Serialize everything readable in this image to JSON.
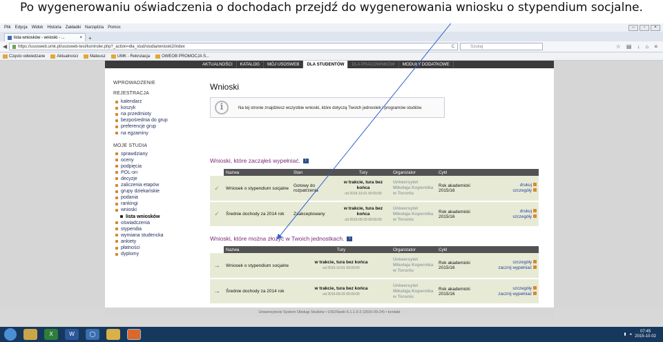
{
  "caption": "Po wygenerowaniu oświadczenia o dochodach  przejdź do wygenerowania wniosku o stypendium socjalne.",
  "browser": {
    "menu": [
      "Plik",
      "Edycja",
      "Widok",
      "Historia",
      "Zakładki",
      "Narzędzia",
      "Pomoc"
    ],
    "tab_title": "lista wniosków - wnioski - ...",
    "tab_close": "×",
    "new_tab": "+",
    "url": "https://usosweb.umk.pl/usosweb-test/kontroler.php?_action=dla_stud/studia/wnioski2/index",
    "search_placeholder": "Szukaj",
    "win_min": "–",
    "win_max": "▫",
    "win_close": "×",
    "back": "◀",
    "reload": "C",
    "bookmarks": [
      "Często odwiedzane",
      "Aktualności",
      "Mateusz",
      "UMK - Rekrutacja",
      "OWEOB PROMOCJA S..."
    ]
  },
  "topnav": {
    "items": [
      "AKTUALNOŚCI",
      "KATALOG",
      "MÓJ USOSWEB",
      "DLA STUDENTÓW",
      "DLA PRACOWNIKÓW",
      "MODUŁY DODATKOWE"
    ],
    "active": "DLA STUDENTÓW"
  },
  "sidebar": {
    "intro": "WPROWADZENIE",
    "reg_title": "REJESTRACJA",
    "reg_items": [
      "kalendarz",
      "koszyk",
      "na przedmioty",
      "bezpośrednia do grup",
      "preferencje grup",
      "na egzaminy"
    ],
    "study_title": "MOJE STUDIA",
    "study_items": [
      "sprawdziany",
      "oceny",
      "podpięcia",
      "POL-on",
      "decyzje",
      "zaliczenia etapów",
      "grupy dziekańskie",
      "podania",
      "rankingi",
      "wnioski",
      "lista wniosków",
      "oświadczenia",
      "stypendia",
      "wymiana studencka",
      "ankiety",
      "płatności",
      "dyplomy"
    ]
  },
  "main": {
    "title": "Wnioski",
    "info": "Na tej stronie znajdziesz wszystkie wnioski, które dotyczą Twoich jednostek i programów studiów.",
    "filled_title": "Wnioski, które zacząłeś wypełniać.",
    "filled_headers": [
      "Nazwa",
      "Stan",
      "Tury",
      "Organizator",
      "Cykl"
    ],
    "filled_rows": [
      {
        "name": "Wniosek o stypendium socjalne",
        "status": "Gotowy do rozpatrzenia",
        "tour": "w trakcie, tura bez końca",
        "tour_from": "od 2015-10-01 00:00:00",
        "org": "Uniwersytet Mikołaja Kopernika w Toruniu",
        "cycle": "Rok akademicki 2015/16",
        "link1": "drukuj",
        "link2": "szczegóły"
      },
      {
        "name": "Średnie dochody za 2014 rok",
        "status": "Zaakceptowany",
        "tour": "w trakcie, tura bez końca",
        "tour_from": "od 2015-09-29 00:00:00",
        "org": "Uniwersytet Mikołaja Kopernika w Toruniu",
        "cycle": "Rok akademicki 2015/16",
        "link1": "drukuj",
        "link2": "szczegóły"
      }
    ],
    "avail_title": "Wnioski, które można złożyć w Twoich jednostkach.",
    "avail_headers": [
      "Nazwa",
      "Tury",
      "Organizator",
      "Cykl"
    ],
    "avail_rows": [
      {
        "name": "Wniosek o stypendium socjalne",
        "tour": "w trakcie, tura bez końca",
        "tour_from": "od 2015-10-01 00:00:00",
        "org": "Uniwersytet Mikołaja Kopernika w Toruniu",
        "cycle": "Rok akademicki 2015/16",
        "link1": "szczegóły",
        "link2": "zacznij wypełniać"
      },
      {
        "name": "Średnie dochody za 2014 rok",
        "tour": "w trakcie, tura bez końca",
        "tour_from": "od 2015-09-29 00:00:00",
        "org": "Uniwersytet Mikołaja Kopernika w Toruniu",
        "cycle": "Rok akademicki 2015/16",
        "link1": "szczegóły",
        "link2": "zacznij wypełniać"
      }
    ]
  },
  "footer": "Uniwersytecki System Obsługi Studiów • USOSweb 6.1.1.0-2 (2015-09-24) • kontakt",
  "taskbar": {
    "time": "07:45",
    "date": "2015-10-02"
  },
  "colors": {
    "accent": "#7a2a78",
    "nav_dark": "#3a3a3a",
    "row_bg": "#e7ebd6",
    "link": "#2a3f9a",
    "arrow": "#2f62c9"
  }
}
